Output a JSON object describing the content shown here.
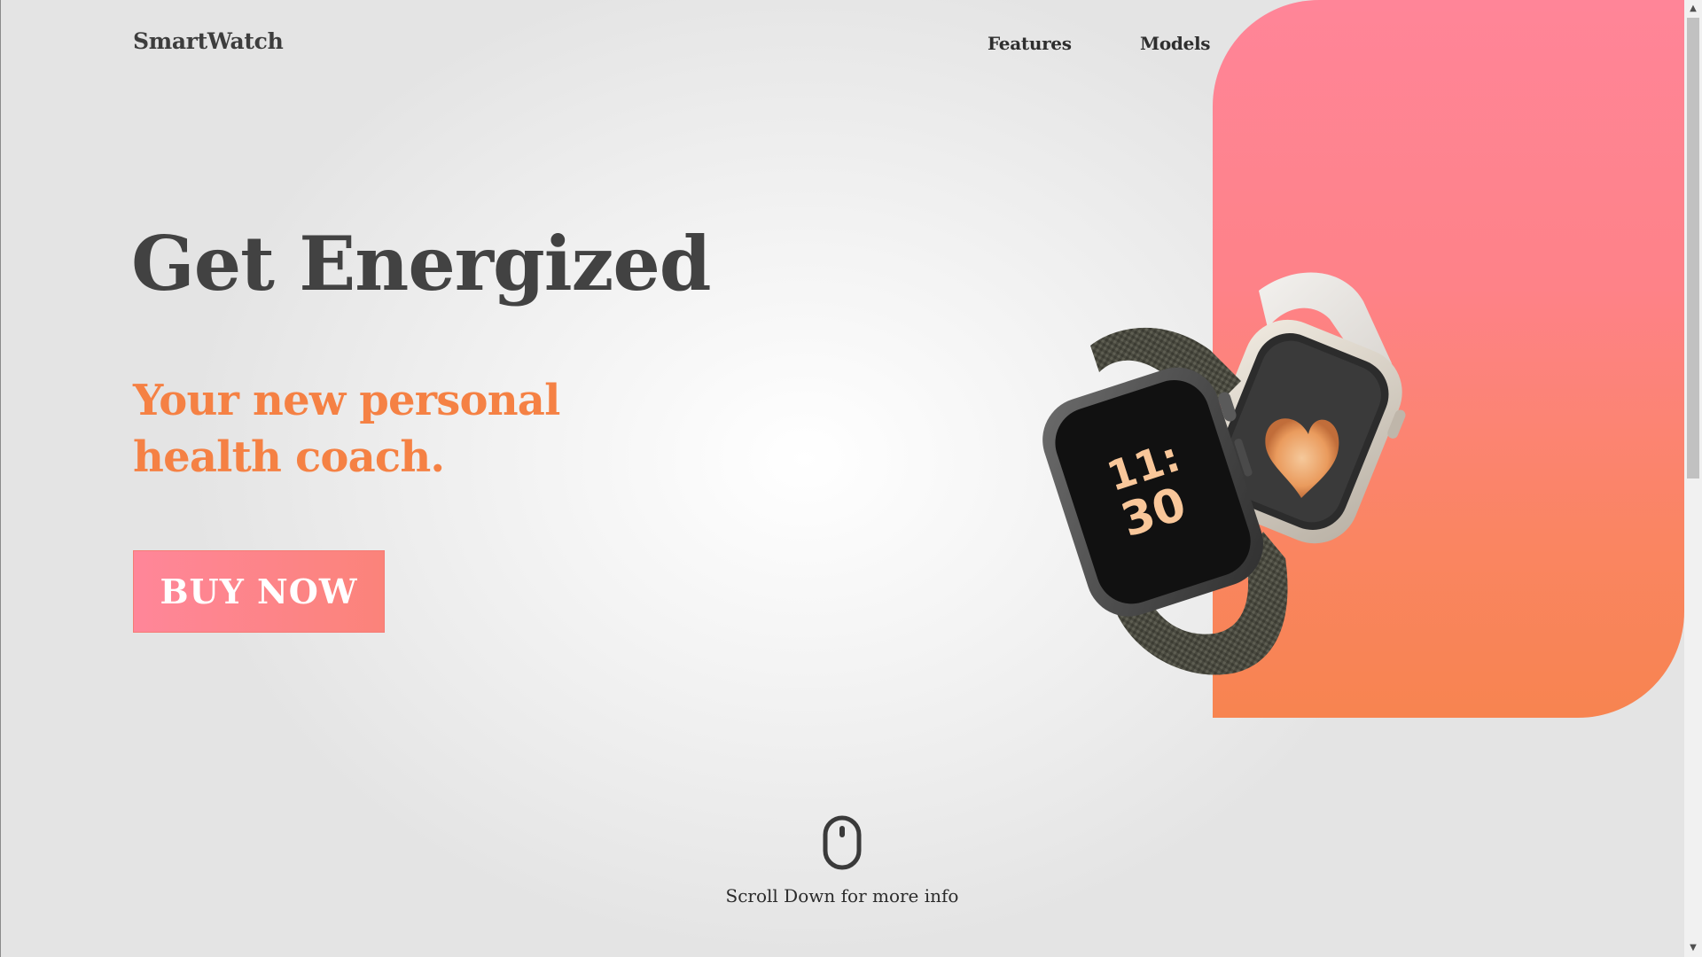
{
  "nav": {
    "brand": "SmartWatch",
    "links": [
      "Features",
      "Models"
    ]
  },
  "hero": {
    "title": "Get Energized",
    "subtitle_line1": "Your new personal",
    "subtitle_line2": "health coach.",
    "cta_label": "BUY NOW"
  },
  "watch_display": {
    "time_hours": "11:",
    "time_minutes": "30"
  },
  "scroll": {
    "hint": "Scroll Down for more info"
  },
  "colors": {
    "accent_orange": "#f58144",
    "panel_top": "#ff8598",
    "panel_bottom": "#f78450",
    "heading_gray": "#424242"
  },
  "icons": {
    "mouse": "mouse-icon",
    "heart": "heart-icon",
    "scroll_up": "scroll-up-arrow",
    "scroll_down": "scroll-down-arrow"
  }
}
